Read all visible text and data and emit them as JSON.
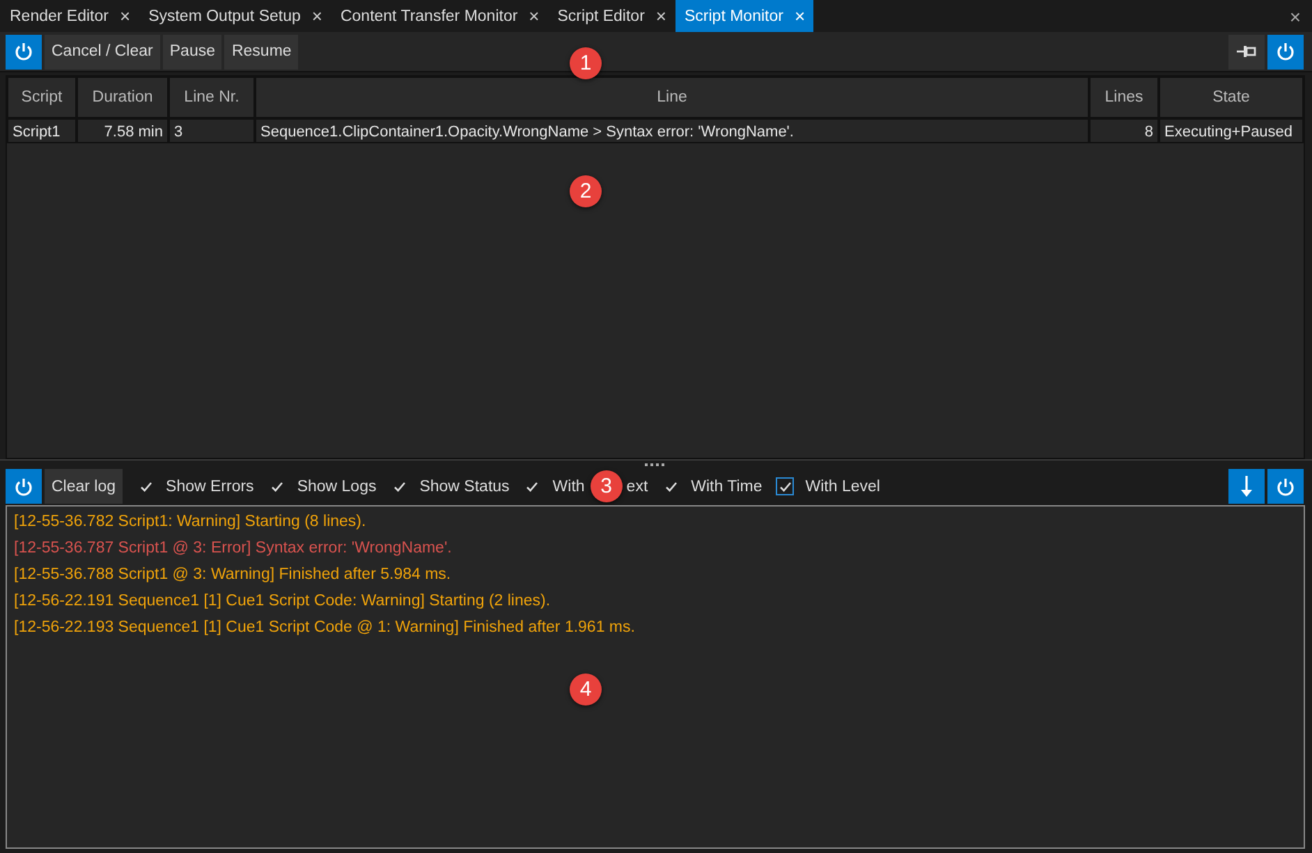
{
  "tabs": [
    {
      "label": "Render Editor",
      "selected": false,
      "close": "×"
    },
    {
      "label": "System Output Setup",
      "selected": false,
      "close": "×"
    },
    {
      "label": "Content Transfer Monitor",
      "selected": false,
      "close": "×"
    },
    {
      "label": "Script Editor",
      "selected": false,
      "close": "×"
    },
    {
      "label": "Script Monitor",
      "selected": true,
      "close": "×"
    }
  ],
  "window_close": "×",
  "toolbar": {
    "power_on": true,
    "buttons": [
      "Cancel / Clear",
      "Pause",
      "Resume"
    ]
  },
  "table": {
    "columns": [
      {
        "label": "Script"
      },
      {
        "label": "Duration"
      },
      {
        "label": "Line Nr."
      },
      {
        "label": "Line"
      },
      {
        "label": "Lines"
      },
      {
        "label": "State"
      }
    ],
    "rows": [
      [
        "Script1",
        "7.58 min",
        "3",
        "Sequence1.ClipContainer1.Opacity.WrongName > Syntax error: 'WrongName'.",
        "8",
        "Executing+Paused"
      ]
    ]
  },
  "log_toolbar": {
    "clear_button": "Clear log",
    "options": [
      {
        "label": "Show Errors",
        "checked": true
      },
      {
        "label": "Show Logs",
        "checked": true
      },
      {
        "label": "Show Status",
        "checked": true
      },
      {
        "label": "With",
        "label_end": "ext",
        "checked": true
      },
      {
        "label": "With Time",
        "checked": true
      },
      {
        "label": "With Level",
        "checked": true,
        "focused": true
      }
    ]
  },
  "log": [
    {
      "is_error": false,
      "text": "[12-55-36.782 Script1: Warning] Starting (8 lines)."
    },
    {
      "is_error": true,
      "text": "[12-55-36.787 Script1 @ 3: Error] Syntax error: 'WrongName'."
    },
    {
      "is_error": false,
      "text": "[12-55-36.788 Script1 @ 3: Warning] Finished after 5.984 ms."
    },
    {
      "is_error": false,
      "text": "[12-56-22.191 Sequence1 [1] Cue1 Script Code: Warning] Starting (2 lines)."
    },
    {
      "is_error": false,
      "text": "[12-56-22.193 Sequence1 [1] Cue1 Script Code @ 1: Warning] Finished after 1.961 ms."
    }
  ],
  "callouts": [
    "1",
    "2",
    "3",
    "4"
  ]
}
